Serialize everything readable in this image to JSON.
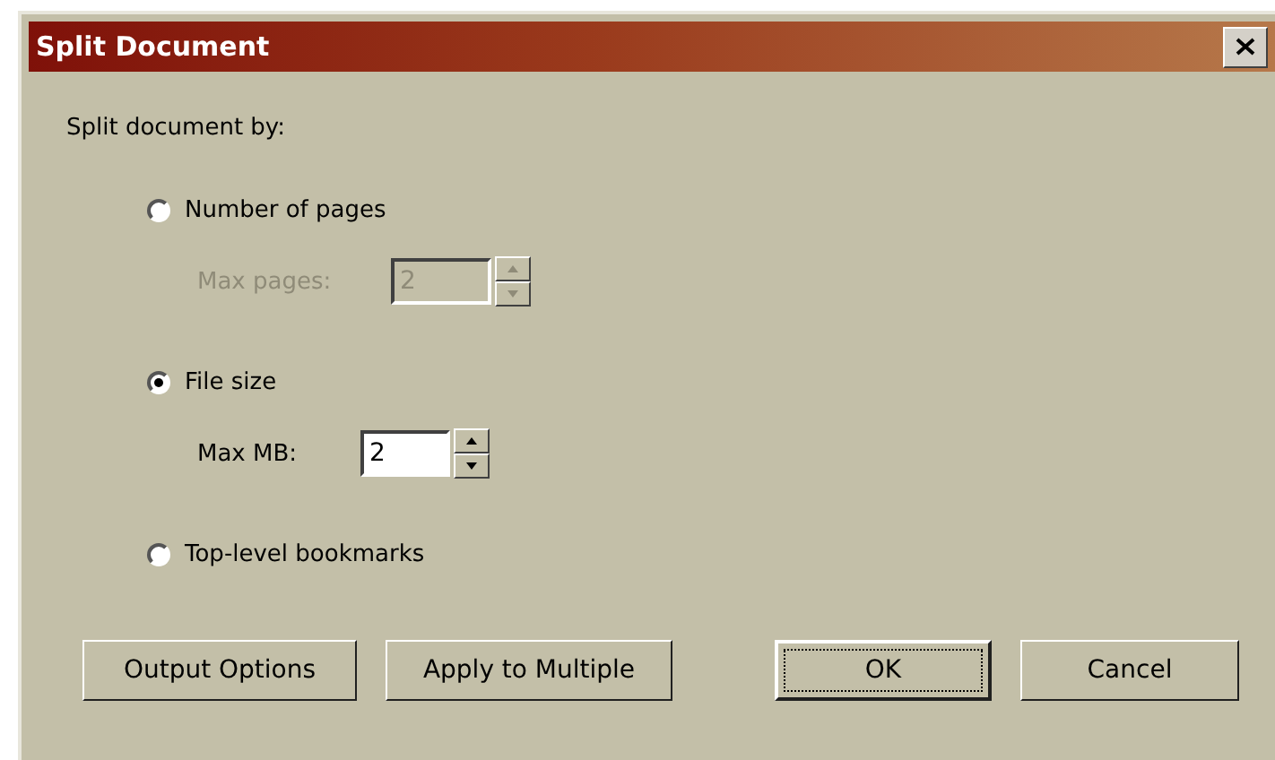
{
  "window": {
    "title": "Split Document"
  },
  "group_label": "Split document by:",
  "options": [
    {
      "label": "Number of pages",
      "selected": false,
      "field": {
        "label": "Max pages:",
        "value": "2",
        "disabled": true
      }
    },
    {
      "label": "File size",
      "selected": true,
      "field": {
        "label": "Max MB:",
        "value": "2",
        "disabled": false
      }
    },
    {
      "label": "Top-level bookmarks",
      "selected": false
    }
  ],
  "left_buttons": [
    {
      "label": "Output Options",
      "default": false
    },
    {
      "label": "Apply to Multiple",
      "default": false
    }
  ],
  "right_buttons": [
    {
      "label": "OK",
      "default": true
    },
    {
      "label": "Cancel",
      "default": false
    }
  ]
}
